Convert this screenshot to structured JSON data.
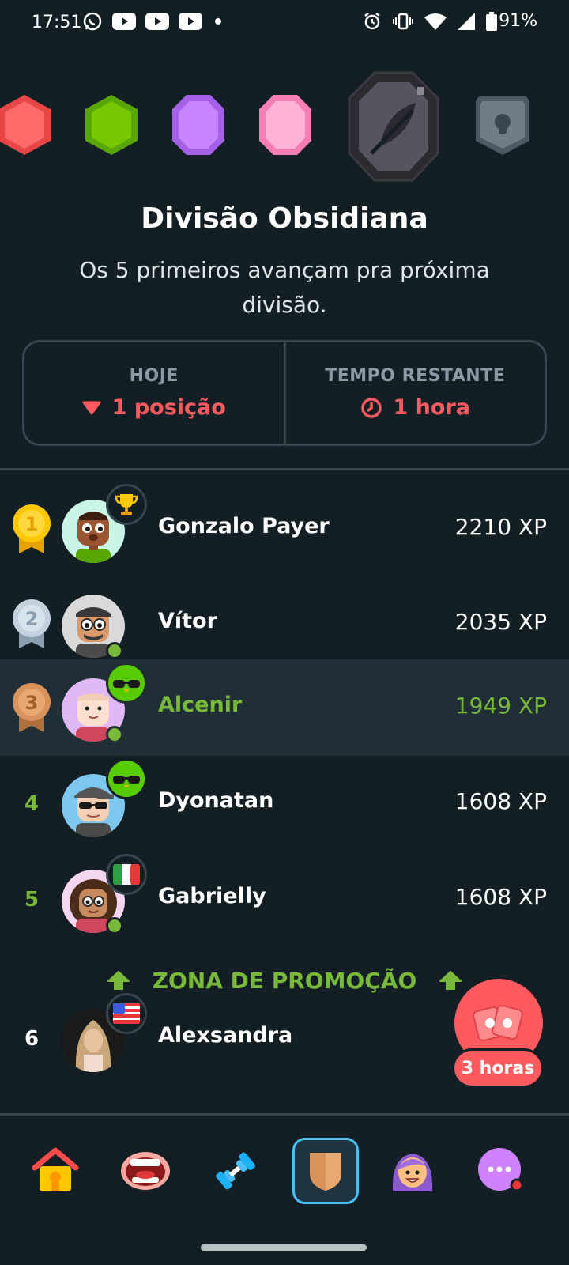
{
  "status_bar": {
    "time": "17:51",
    "left_icons": [
      "whatsapp-icon",
      "youtube-icon",
      "youtube-icon",
      "youtube-icon",
      "dot-icon"
    ],
    "right_icons": [
      "alarm-icon",
      "vibrate-icon",
      "wifi-icon",
      "signal-icon",
      "battery-icon"
    ],
    "battery": "91%"
  },
  "league_badges": [
    "ruby-badge",
    "emerald-badge",
    "amethyst-badge",
    "pearl-badge",
    "obsidian-badge",
    "locked-diamond-badge"
  ],
  "division": {
    "title": "Divisão Obsidiana",
    "subtitle": "Os 5 primeiros avançam pra próxima divisão."
  },
  "stats": {
    "today_label": "HOJE",
    "today_value": "1 posição",
    "time_label": "TEMPO RESTANTE",
    "time_value": "1 hora"
  },
  "leaderboard": [
    {
      "rank": "1",
      "name": "Gonzalo Payer",
      "xp": "2210 XP",
      "badge": "trophy-icon",
      "online": false,
      "medal": "gold"
    },
    {
      "rank": "2",
      "name": "Vítor",
      "xp": "2035 XP",
      "badge": "",
      "online": true,
      "medal": "silver"
    },
    {
      "rank": "3",
      "name": "Alcenir",
      "xp": "1949 XP",
      "badge": "duo-sunglasses-icon",
      "online": true,
      "medal": "bronze",
      "is_me": true
    },
    {
      "rank": "4",
      "name": "Dyonatan",
      "xp": "1608 XP",
      "badge": "duo-sunglasses-icon",
      "online": false
    },
    {
      "rank": "5",
      "name": "Gabrielly",
      "xp": "1608 XP",
      "badge": "italy-flag-icon",
      "online": true
    },
    {
      "rank": "6",
      "name": "Alexsandra",
      "xp": "",
      "badge": "usa-flag-icon",
      "online": false
    }
  ],
  "promotion_zone": "ZONA DE PROMOÇÃO",
  "fab": {
    "label": "3 horas",
    "icon": "double-xp-icon"
  },
  "nav": [
    "home-icon",
    "speaking-icon",
    "practice-icon",
    "leagues-icon",
    "profile-icon",
    "more-icon"
  ],
  "colors": {
    "background": "#131f24",
    "green": "#79b93a",
    "red": "#ff5a5f",
    "border": "#37464f",
    "highlight_row": "#202f36"
  }
}
